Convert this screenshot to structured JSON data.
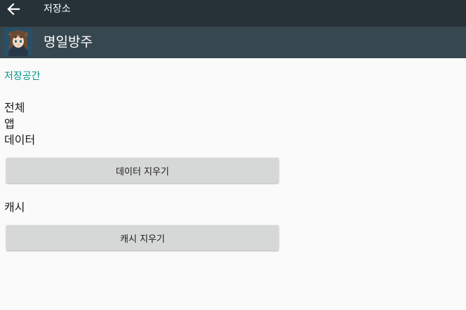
{
  "appbar": {
    "back_icon": "arrow-back-icon",
    "title": "저장소",
    "background": "#263238"
  },
  "app_header": {
    "icon": "anime-girl-app-icon",
    "name": "명일방주",
    "background": "#37474f"
  },
  "storage": {
    "section_label": "저장공간",
    "accent": "#009688",
    "rows": [
      {
        "label": "전체"
      },
      {
        "label": "앱"
      },
      {
        "label": "데이터"
      }
    ],
    "clear_data_label": "데이터 지우기"
  },
  "cache": {
    "label": "캐시",
    "clear_cache_label": "캐시 지우기"
  }
}
